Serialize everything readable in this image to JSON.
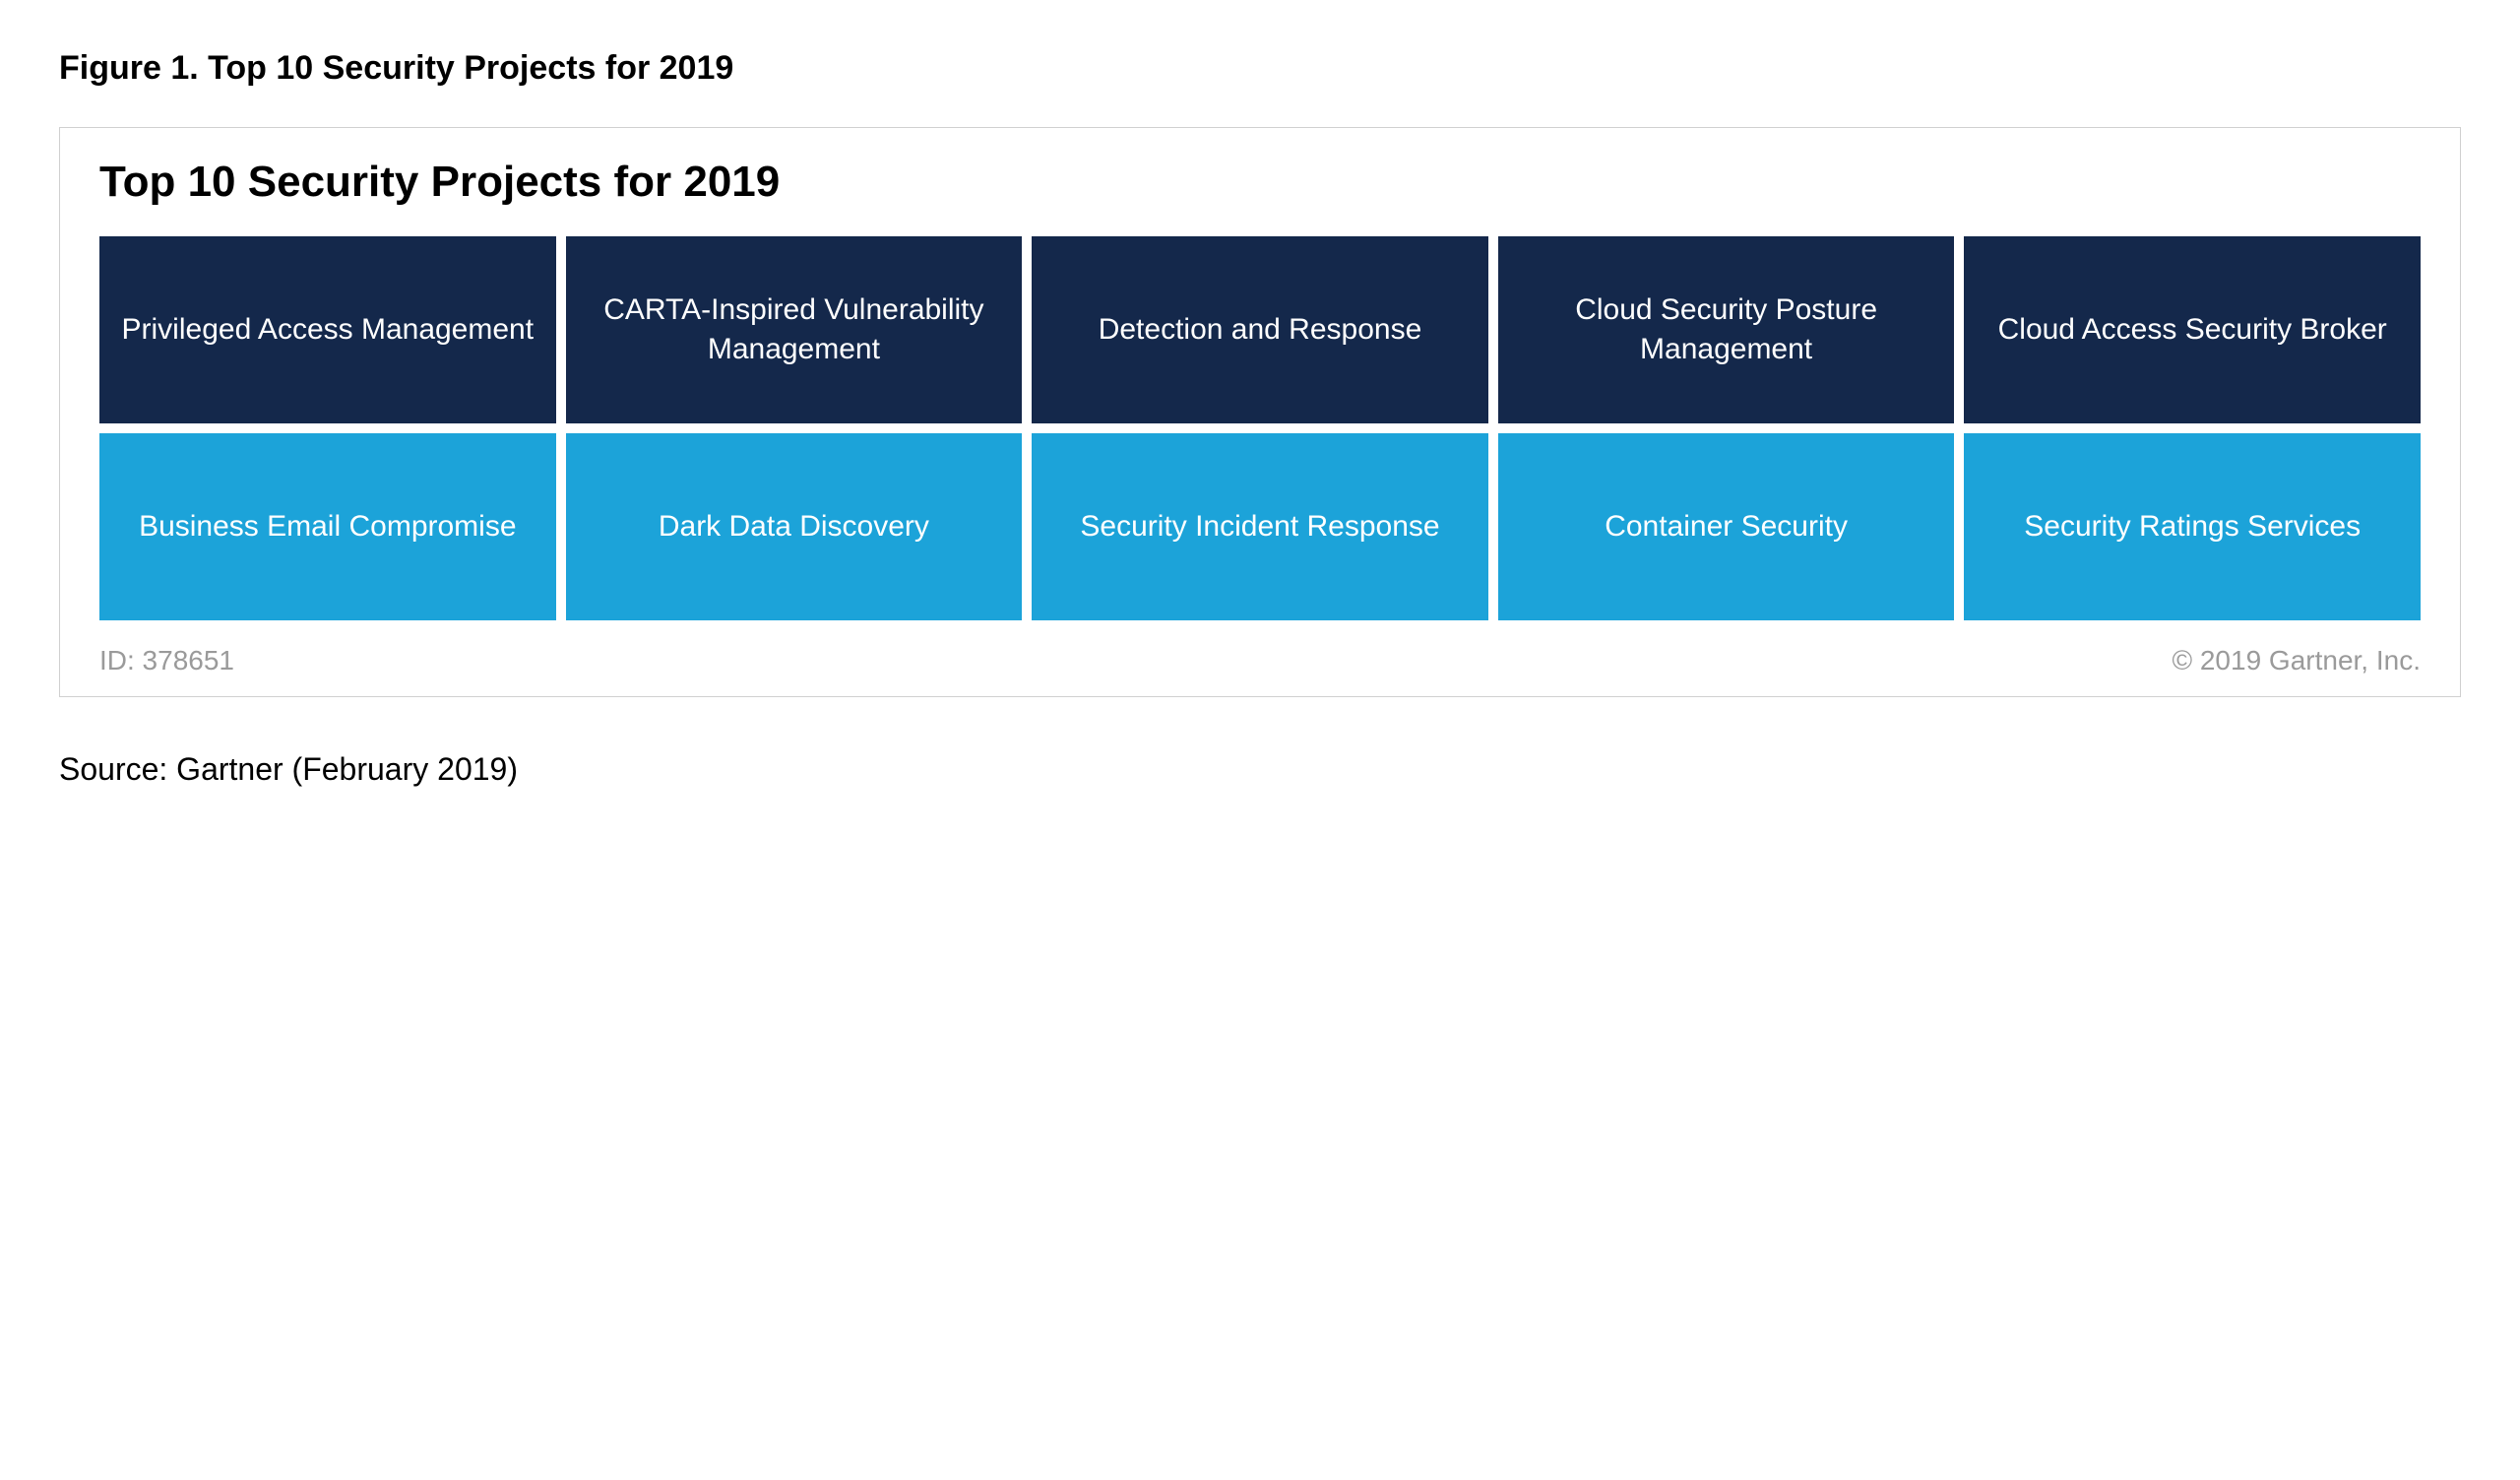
{
  "figure_caption": "Figure 1. Top 10 Security Projects for 2019",
  "chart_title": "Top 10 Security Projects for 2019",
  "row1": [
    "Privileged Access Management",
    "CARTA-Inspired Vulnerability Management",
    "Detection and Response",
    "Cloud Security Posture Management",
    "Cloud Access Security Broker"
  ],
  "row2": [
    "Business Email Compromise",
    "Dark Data Discovery",
    "Security Incident Response",
    "Container Security",
    "Security Ratings Services"
  ],
  "footer_id": "ID: 378651",
  "footer_copyright": "© 2019 Gartner, Inc.",
  "source_line": "Source: Gartner (February 2019)",
  "colors": {
    "row1_bg": "#14284b",
    "row2_bg": "#1ca3d9"
  },
  "chart_data": {
    "type": "table",
    "title": "Top 10 Security Projects for 2019",
    "rows": 2,
    "cols": 5,
    "cells": [
      [
        "Privileged Access Management",
        "CARTA-Inspired Vulnerability Management",
        "Detection and Response",
        "Cloud Security Posture Management",
        "Cloud Access Security Broker"
      ],
      [
        "Business Email Compromise",
        "Dark Data Discovery",
        "Security Incident Response",
        "Container Security",
        "Security Ratings Services"
      ]
    ]
  }
}
